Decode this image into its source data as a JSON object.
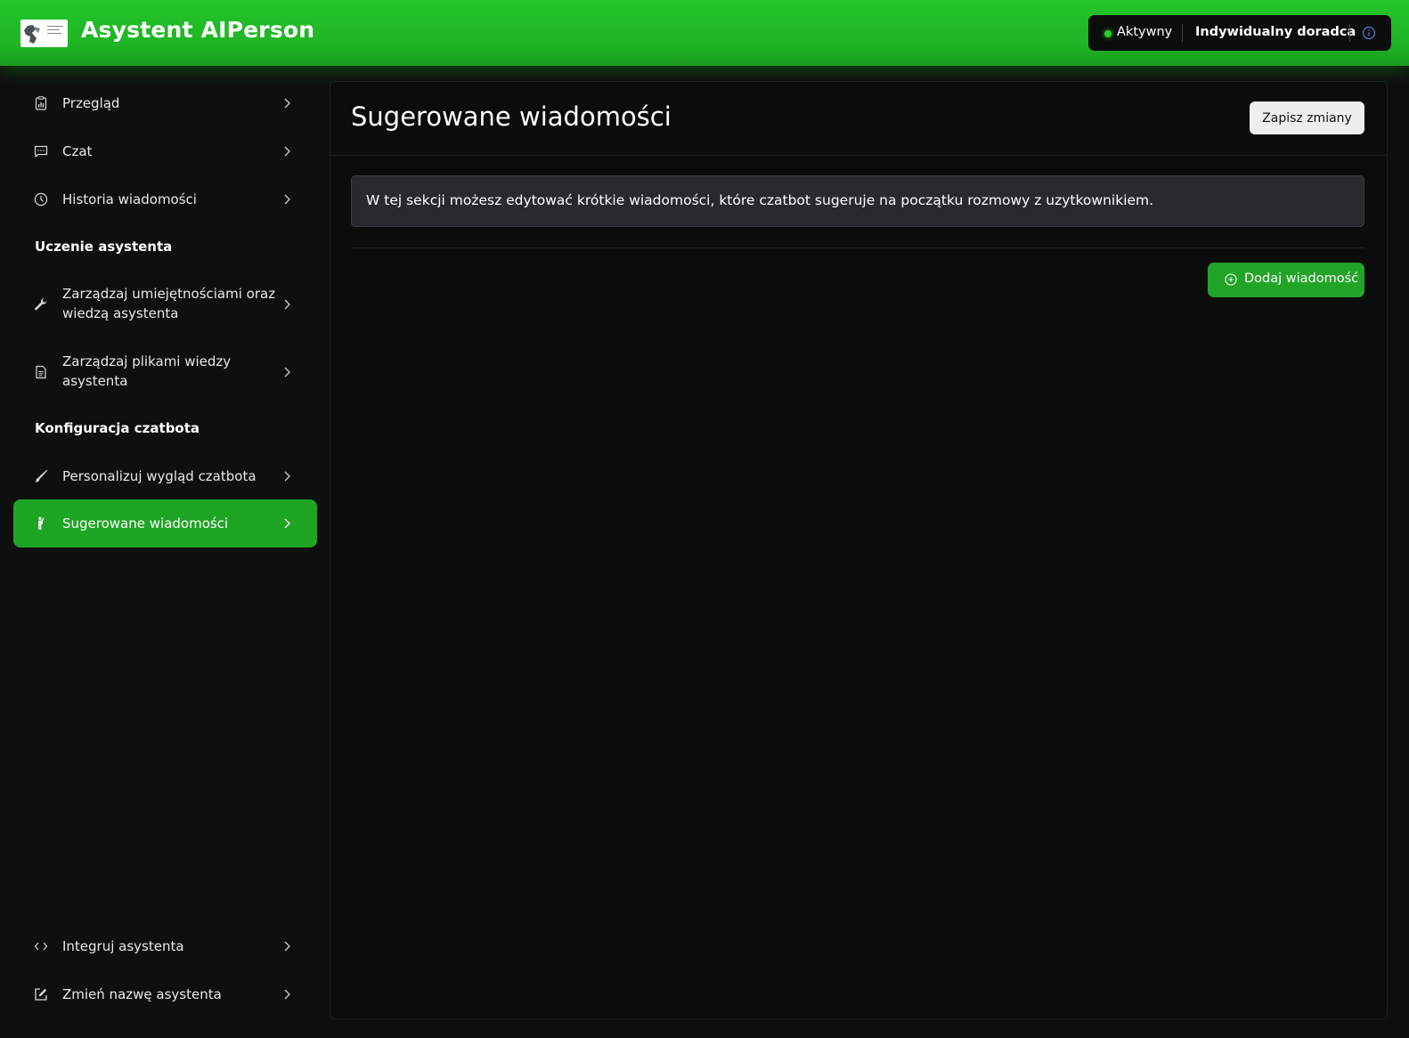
{
  "header": {
    "brand": "Asystent AIPerson",
    "status": "Aktywny",
    "plan": "Indywidualny doradca",
    "icons": {
      "logo": "brand-logo",
      "info": "info-icon"
    },
    "colors": {
      "header_green": "#20bb26",
      "status_dot": "#27d02c"
    }
  },
  "sidebar": {
    "items_top": [
      {
        "label": "Przegląd",
        "icon": "clipboard-chart-icon"
      },
      {
        "label": "Czat",
        "icon": "chat-bubble-icon"
      },
      {
        "label": "Historia wiadomości",
        "icon": "clock-icon"
      }
    ],
    "section_learning": "Uczenie asystenta",
    "items_learning": [
      {
        "label": "Zarządzaj umiejętnościami oraz wiedzą asystenta",
        "icon": "wrench-icon"
      },
      {
        "label": "Zarządzaj plikami wiedzy asystenta",
        "icon": "document-icon"
      }
    ],
    "section_config": "Konfiguracja czatbota",
    "items_config": [
      {
        "label": "Personalizuj wygląd czatbota",
        "icon": "brush-icon"
      },
      {
        "label": "Sugerowane wiadomości",
        "icon": "person-waving-icon",
        "active": true
      }
    ],
    "items_bottom": [
      {
        "label": "Integruj asystenta",
        "icon": "code-icon"
      },
      {
        "label": "Zmień nazwę asystenta",
        "icon": "edit-icon"
      }
    ],
    "active_color": "#1fa524"
  },
  "main": {
    "title": "Sugerowane wiadomości",
    "save_label": "Zapisz zmiany",
    "info_text": "W tej sekcji możesz edytować krótkie wiadomości, które czatbot sugeruje na początku rozmowy z uzytkownikiem.",
    "add_label": "Dodaj wiadomość",
    "add_icon": "plus-circle-icon"
  }
}
